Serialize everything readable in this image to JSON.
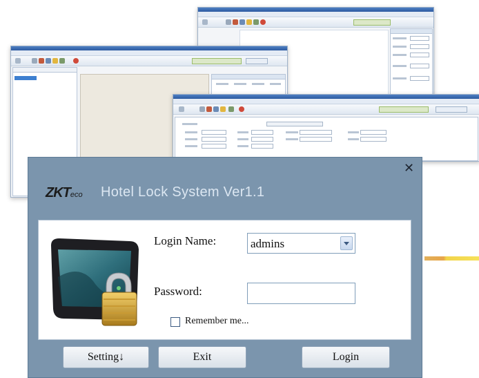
{
  "background": {
    "accent_bar_color": "#2c5aa0",
    "strip_colors": [
      "#e8a54a",
      "#f6e15a"
    ]
  },
  "dialog": {
    "close_icon": "close-icon",
    "brand": {
      "main": "ZKT",
      "suffix": "eco"
    },
    "title": "Hotel Lock System Ver1.1",
    "image_icon": "monitor-with-padlock-icon",
    "login_name_label": "Login Name:",
    "login_name_value": "admins",
    "password_label": "Password:",
    "password_value": "",
    "remember_label": "Remember me...",
    "remember_checked": false,
    "buttons": {
      "setting": "Setting↓",
      "exit": "Exit",
      "login": "Login"
    }
  }
}
